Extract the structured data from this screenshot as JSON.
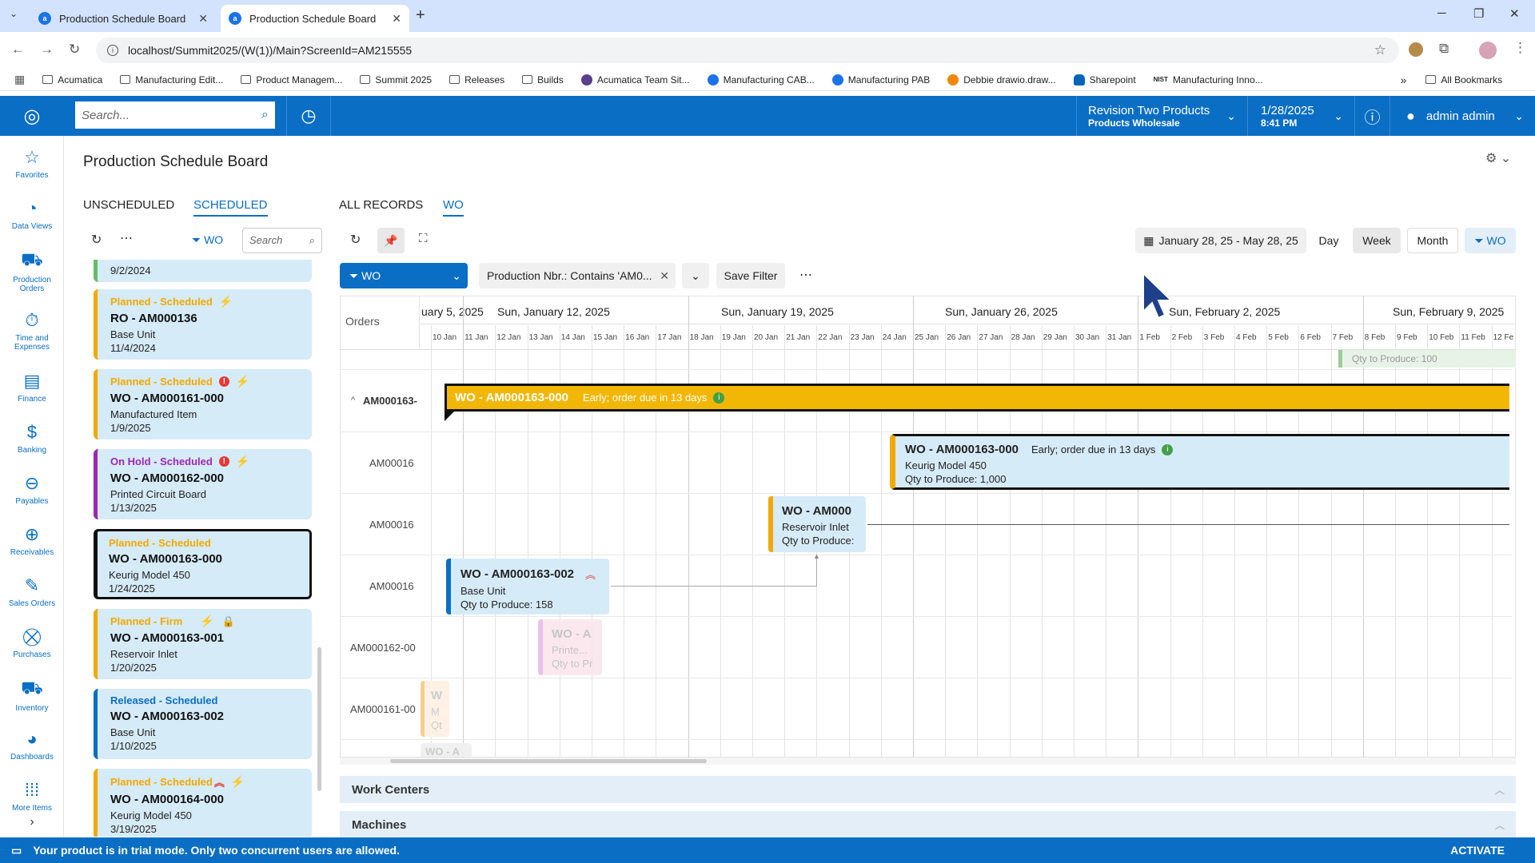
{
  "browser": {
    "tabs": [
      {
        "title": "Production Schedule Board"
      },
      {
        "title": "Production Schedule Board"
      }
    ],
    "url": "localhost/Summit2025/(W(1))/Main?ScreenId=AM215555",
    "bookmarks": [
      "Acumatica",
      "Manufacturing Edit...",
      "Product Managem...",
      "Summit 2025",
      "Releases",
      "Builds",
      "Acumatica Team Sit...",
      "Manufacturing CAB...",
      "Manufacturing PAB",
      "Debbie drawio.draw...",
      "Sharepoint",
      "Manufacturing Inno..."
    ],
    "all_bookmarks": "All Bookmarks"
  },
  "header": {
    "search_placeholder": "Search...",
    "company": "Revision Two Products",
    "branch": "Products Wholesale",
    "date": "1/28/2025",
    "time": "8:41 PM",
    "user": "admin admin"
  },
  "nav": [
    {
      "label": "Favorites"
    },
    {
      "label": "Data Views"
    },
    {
      "label": "Production Orders"
    },
    {
      "label": "Time and Expenses"
    },
    {
      "label": "Finance"
    },
    {
      "label": "Banking"
    },
    {
      "label": "Payables"
    },
    {
      "label": "Receivables"
    },
    {
      "label": "Sales Orders"
    },
    {
      "label": "Purchases"
    },
    {
      "label": "Inventory"
    },
    {
      "label": "Dashboards"
    },
    {
      "label": "More Items"
    }
  ],
  "page": {
    "title": "Production Schedule Board",
    "left_tabs": [
      "UNSCHEDULED",
      "SCHEDULED"
    ],
    "right_tabs": [
      "ALL RECORDS",
      "WO"
    ],
    "filter_label": "WO",
    "search_placeholder": "Search"
  },
  "cards": {
    "partial_date": "9/2/2024",
    "items": [
      {
        "status": "Planned - Scheduled",
        "name": "RO - AM000136",
        "item": "Base Unit",
        "date": "11/4/2024"
      },
      {
        "status": "Planned - Scheduled",
        "name": "WO - AM000161-000",
        "item": "Manufactured Item",
        "date": "1/9/2025"
      },
      {
        "status": "On Hold - Scheduled",
        "name": "WO - AM000162-000",
        "item": "Printed Circuit Board",
        "date": "1/13/2025"
      },
      {
        "status": "Planned - Scheduled",
        "name": "WO - AM000163-000",
        "item": "Keurig Model 450",
        "date": "1/24/2025"
      },
      {
        "status": "Planned - Firm",
        "name": "WO - AM000163-001",
        "item": "Reservoir Inlet",
        "date": "1/20/2025"
      },
      {
        "status": "Released - Scheduled",
        "name": "WO - AM000163-002",
        "item": "Base Unit",
        "date": "1/10/2025"
      },
      {
        "status": "Planned - Scheduled",
        "name": "WO - AM000164-000",
        "item": "Keurig Model 450",
        "date": "3/19/2025"
      }
    ]
  },
  "gantt": {
    "date_range": "January 28, 25 - May 28, 25",
    "views": [
      "Day",
      "Week",
      "Month"
    ],
    "filter_chip": "WO",
    "filter_select": "WO",
    "filter_condition": "Production Nbr.: Contains 'AM0...",
    "save_filter": "Save Filter",
    "orders_label": "Orders",
    "weeks": [
      "uary 5, 2025",
      "Sun, January 12, 2025",
      "Sun, January 19, 2025",
      "Sun, January 26, 2025",
      "Sun, February 2, 2025",
      "Sun, February 9, 2025"
    ],
    "days": [
      "10 Jan",
      "11 Jan",
      "12 Jan",
      "13 Jan",
      "14 Jan",
      "15 Jan",
      "16 Jan",
      "17 Jan",
      "18 Jan",
      "19 Jan",
      "20 Jan",
      "21 Jan",
      "22 Jan",
      "23 Jan",
      "24 Jan",
      "25 Jan",
      "26 Jan",
      "27 Jan",
      "28 Jan",
      "29 Jan",
      "30 Jan",
      "31 Jan",
      "1 Feb",
      "2 Feb",
      "3 Feb",
      "4 Feb",
      "5 Feb",
      "6 Feb",
      "7 Feb",
      "8 Feb",
      "9 Feb",
      "10 Feb",
      "11 Feb",
      "12 Fe"
    ],
    "rows": [
      "AM000163-",
      "AM00016",
      "AM00016",
      "AM00016",
      "AM000162-00",
      "AM000161-00"
    ],
    "top_partial": "Qty to Produce: 100",
    "bars": {
      "main": {
        "title": "WO - AM000163-000",
        "note": "Early; order due in 13 days"
      },
      "b1": {
        "title": "WO - AM000163-000",
        "note": "Early; order due in 13 days",
        "item": "Keurig Model 450",
        "qty": "Qty to Produce: 1,000"
      },
      "b2": {
        "title": "WO - AM000",
        "item": "Reservoir Inlet",
        "qty": "Qty to Produce:"
      },
      "b3": {
        "title": "WO - AM000163-002",
        "item": "Base Unit",
        "qty": "Qty to Produce: 158"
      },
      "b4": {
        "title": "WO - A",
        "item": "Printe...",
        "qty": "Qty to Pr"
      },
      "b5": {
        "title": "W",
        "item": "M",
        "qty": "Qt"
      },
      "b6": {
        "title": "WO - A"
      }
    },
    "sections": [
      "Work Centers",
      "Machines"
    ]
  },
  "footer": {
    "message": "Your product is in trial mode. Only two concurrent users are allowed.",
    "action": "ACTIVATE"
  },
  "colors": {
    "brand": "#0a6ec4",
    "planned": "#f2a900",
    "onhold": "#9c27b0",
    "released": "#0a6ec4",
    "card": "#d6ebf8"
  }
}
